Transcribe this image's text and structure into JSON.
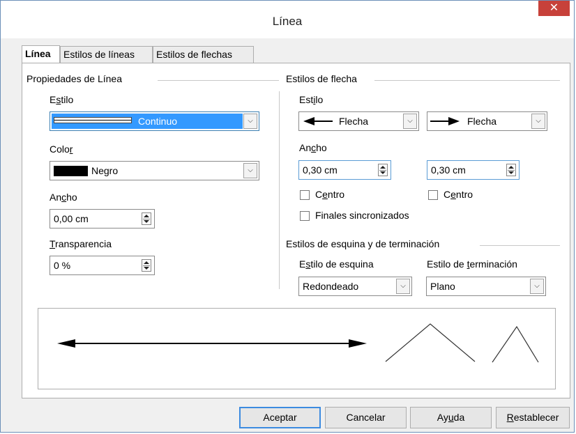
{
  "window": {
    "title": "Línea",
    "close_glyph": "✕"
  },
  "tabs": [
    {
      "label": "Línea",
      "active": true
    },
    {
      "label": "Estilos de líneas",
      "active": false
    },
    {
      "label": "Estilos de flechas",
      "active": false
    }
  ],
  "line_properties": {
    "section_title": "Propiedades de Línea",
    "style": {
      "label": "Estilo",
      "value": "Continuo"
    },
    "color": {
      "label": "Color",
      "value": "Negro",
      "swatch": "#000000"
    },
    "width": {
      "label": "Ancho",
      "value": "0,00 cm"
    },
    "transparency": {
      "label": "Transparencia",
      "value": "0 %"
    }
  },
  "arrow_styles": {
    "section_title": "Estilos de flecha",
    "style_label": "Estilo",
    "start_style": "Flecha",
    "end_style": "Flecha",
    "width_label": "Ancho",
    "start_width": "0,30 cm",
    "end_width": "0,30 cm",
    "center_label_start": "Centro",
    "center_label_end": "Centro",
    "sync_label": "Finales sincronizados"
  },
  "corner_cap": {
    "section_title": "Estilos de esquina y de terminación",
    "corner_label": "Estilo de esquina",
    "corner_value": "Redondeado",
    "cap_label": "Estilo de terminación",
    "cap_value": "Plano"
  },
  "buttons": {
    "ok": "Aceptar",
    "cancel": "Cancelar",
    "help": "Ayuda",
    "reset": "Restablecer"
  },
  "colors": {
    "accent": "#3399ff",
    "close": "#c7413a",
    "default_button_border": "#3c8be0"
  }
}
